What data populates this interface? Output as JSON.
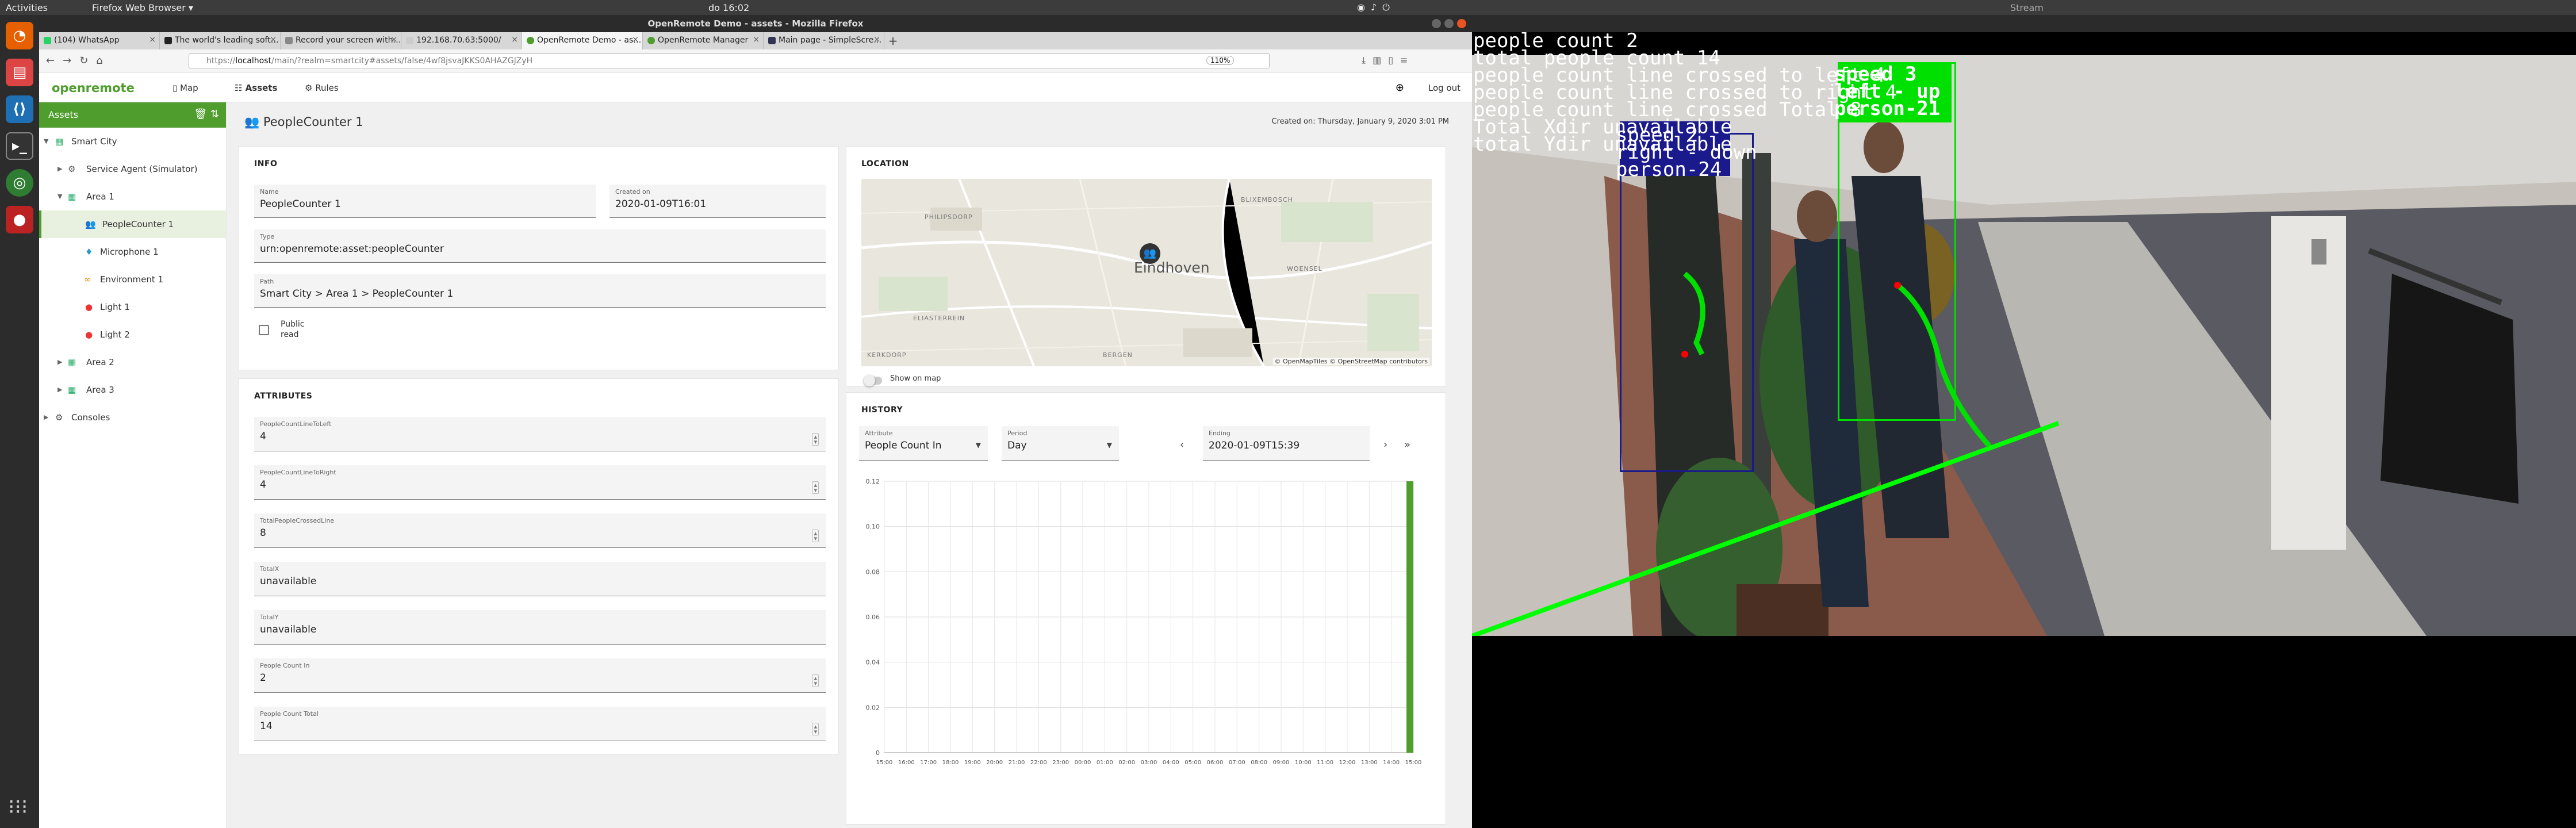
{
  "system": {
    "activities": "Activities",
    "app_menu": "Firefox Web Browser ▾",
    "clock": "do 16:02",
    "stream_window_title": "Stream"
  },
  "browser": {
    "window_title": "OpenRemote Demo - assets - Mozilla Firefox",
    "tabs": [
      {
        "label": "(104) WhatsApp",
        "active": false
      },
      {
        "label": "The world's leading soft…",
        "active": false
      },
      {
        "label": "Record your screen with…",
        "active": false
      },
      {
        "label": "192.168.70.63:5000/",
        "active": false
      },
      {
        "label": "OpenRemote Demo - as…",
        "active": true
      },
      {
        "label": "OpenRemote Manager",
        "active": false
      },
      {
        "label": "Main page - SimpleScre…",
        "active": false
      }
    ],
    "url_prefix": "https://",
    "url_host": "localhost",
    "url_path": "/main/?realm=smartcity#assets/false/4wf8jsvaJKKS0AHAZGJZyH",
    "zoom": "110%"
  },
  "app": {
    "logo": "openremote",
    "nav": {
      "map": "Map",
      "assets": "Assets",
      "rules": "Rules"
    },
    "logout": "Log out"
  },
  "sidebar": {
    "title": "Assets",
    "tree": [
      {
        "label": "Smart City",
        "level": 0,
        "expanded": true,
        "icon": "city-icon"
      },
      {
        "label": "Service Agent (Simulator)",
        "level": 1,
        "expanded": false,
        "icon": "agent-icon"
      },
      {
        "label": "Area 1",
        "level": 1,
        "expanded": true,
        "icon": "area-icon"
      },
      {
        "label": "PeopleCounter 1",
        "level": 2,
        "selected": true,
        "icon": "people-icon"
      },
      {
        "label": "Microphone 1",
        "level": 2,
        "icon": "microphone-icon"
      },
      {
        "label": "Environment 1",
        "level": 2,
        "icon": "environment-icon"
      },
      {
        "label": "Light 1",
        "level": 2,
        "icon": "light-icon"
      },
      {
        "label": "Light 2",
        "level": 2,
        "icon": "light-icon"
      },
      {
        "label": "Area 2",
        "level": 1,
        "expanded": false,
        "icon": "area-icon"
      },
      {
        "label": "Area 3",
        "level": 1,
        "expanded": false,
        "icon": "area-icon"
      },
      {
        "label": "Consoles",
        "level": 0,
        "expanded": false,
        "icon": "console-icon"
      }
    ]
  },
  "asset": {
    "title": "PeopleCounter 1",
    "created": "Created on: Thursday, January 9, 2020 3:01 PM"
  },
  "info": {
    "heading": "INFO",
    "name_label": "Name",
    "name": "PeopleCounter 1",
    "created_label": "Created on",
    "created_value": "2020-01-09T16:01",
    "type_label": "Type",
    "type": "urn:openremote:asset:peopleCounter",
    "path_label": "Path",
    "path": "Smart City > Area 1 > PeopleCounter 1",
    "public_read": "Public read"
  },
  "location": {
    "heading": "LOCATION",
    "city_label": "Eindhoven",
    "districts": [
      "PHILIPSDORP",
      "BLIXEMBOSCH",
      "ELIASTERREIN",
      "BERGEN",
      "WOENSEL",
      "KERKDORP"
    ],
    "attribution": "© OpenMapTiles © OpenStreetMap contributors",
    "show_on_map": "Show on map"
  },
  "attributes": {
    "heading": "ATTRIBUTES",
    "items": [
      {
        "label": "PeopleCountLineToLeft",
        "value": "4",
        "numeric": true
      },
      {
        "label": "PeopleCountLineToRight",
        "value": "4",
        "numeric": true
      },
      {
        "label": "TotalPeopleCrossedLine",
        "value": "8",
        "numeric": true
      },
      {
        "label": "TotalX",
        "value": "unavailable",
        "numeric": false
      },
      {
        "label": "TotalY",
        "value": "unavailable",
        "numeric": false
      },
      {
        "label": "People Count In",
        "value": "2",
        "numeric": true
      },
      {
        "label": "People Count Total",
        "value": "14",
        "numeric": true
      }
    ]
  },
  "history": {
    "heading": "HISTORY",
    "attribute_label": "Attribute",
    "attribute_value": "People Count In",
    "period_label": "Period",
    "period_value": "Day",
    "ending_label": "Ending",
    "ending_value": "2020-01-09T15:39"
  },
  "chart_data": {
    "type": "bar",
    "x": [
      "15:00",
      "16:00",
      "17:00",
      "18:00",
      "19:00",
      "20:00",
      "21:00",
      "22:00",
      "23:00",
      "00:00",
      "01:00",
      "02:00",
      "03:00",
      "04:00",
      "05:00",
      "06:00",
      "07:00",
      "08:00",
      "09:00",
      "10:00",
      "11:00",
      "12:00",
      "13:00",
      "14:00",
      "15:00"
    ],
    "yticks": [
      "0",
      "0.02",
      "0.04",
      "0.06",
      "0.08",
      "0.10",
      "0.12"
    ],
    "ylim": [
      0,
      0.12
    ],
    "values": [
      0,
      0,
      0,
      0,
      0,
      0,
      0,
      0,
      0,
      0,
      0,
      0,
      0,
      0,
      0,
      0,
      0,
      0,
      0,
      0,
      0,
      0,
      0,
      0,
      0.12
    ],
    "bar_color": "#4e9d2d",
    "grid": true
  },
  "stream": {
    "overlay_lines": [
      "people count 2",
      "total people count 14",
      "people count line crossed to left 4",
      "people count line crossed to right 4",
      "people count line crossed Total 8",
      "Total Xdir unavailable",
      "total Ydir unavailable"
    ],
    "tracks": [
      {
        "label_lines": [
          "speed 3",
          "left - up",
          "person-21"
        ],
        "color": "#00e000"
      },
      {
        "label_lines": [
          "speed 2",
          "right - down",
          "person-24"
        ],
        "color": "#1a1a8c"
      }
    ]
  },
  "colors": {
    "brand": "#4e9d2d",
    "accent_orange": "#e95420"
  }
}
